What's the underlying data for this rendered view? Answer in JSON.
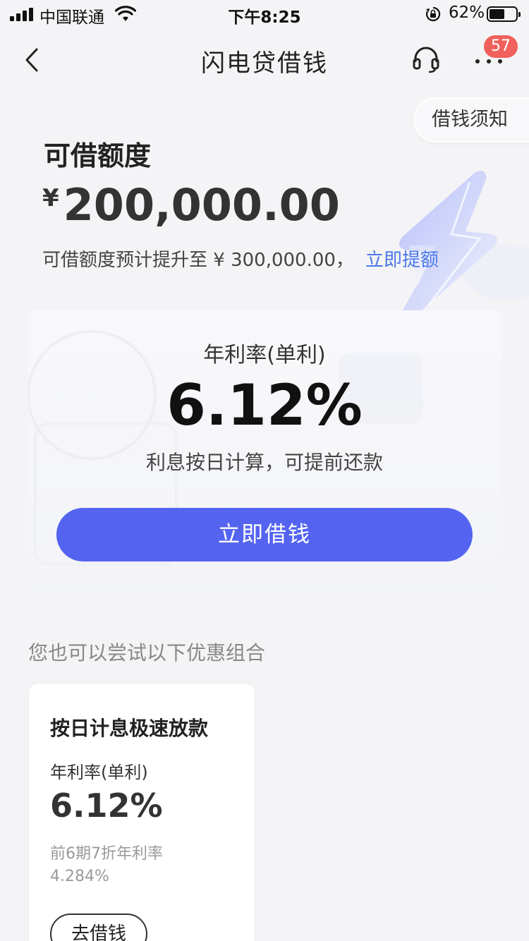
{
  "status_bar": {
    "carrier": "中国联通",
    "time": "下午8:25",
    "battery_percent": "62%",
    "battery_level": 0.62
  },
  "nav": {
    "title": "闪电贷借钱",
    "badge_count": "57"
  },
  "notice_tab": "借钱须知",
  "credit": {
    "title": "可借额度",
    "currency": "¥",
    "amount": "200,000.00",
    "hint": "可借额度预计提升至 ¥ 300,000.00，",
    "hint_link": "立即提额"
  },
  "rate_card": {
    "label": "年利率(单利)",
    "value": "6.12%",
    "description": "利息按日计算，可提前还款",
    "button": "立即借钱"
  },
  "combo_title": "您也可以尝试以下优惠组合",
  "product": {
    "name": "按日计息极速放款",
    "rate_label": "年利率(单利)",
    "rate_value": "6.12%",
    "discount_line1": "前6期7折年利率",
    "discount_line2": "4.284%",
    "button": "去借钱"
  },
  "colors": {
    "accent": "#5464f0",
    "link": "#4a78e8",
    "badge": "#f0605c"
  }
}
